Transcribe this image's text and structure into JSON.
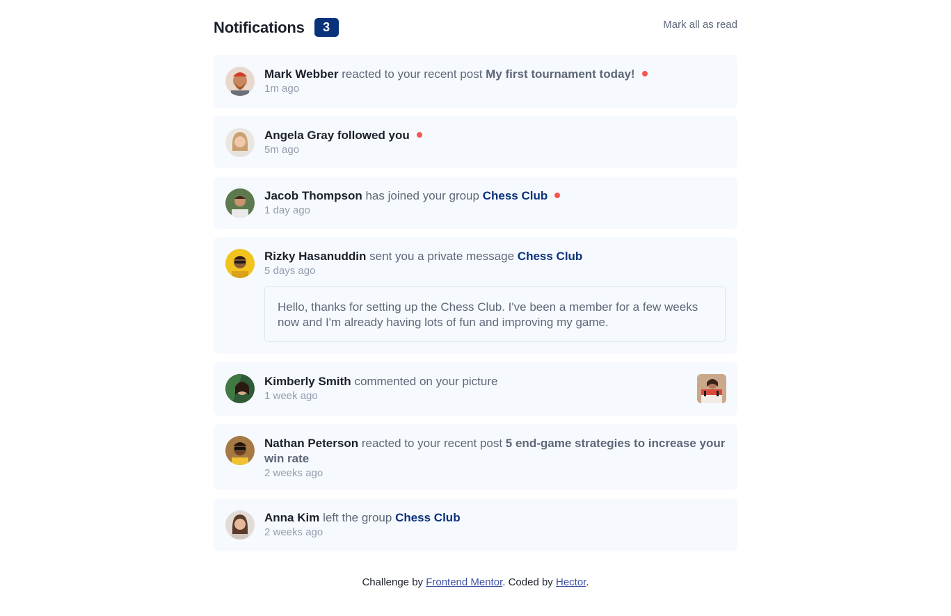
{
  "header": {
    "title": "Notifications",
    "unread_count": "3",
    "mark_all_label": "Mark all as read"
  },
  "notifications": [
    {
      "name": "Mark Webber",
      "action": "reacted to your recent post",
      "target": "My first tournament today!",
      "target_type": "post",
      "time": "1m ago",
      "unread": true,
      "avatar": "avatar-mark-webber"
    },
    {
      "name": "Angela Gray",
      "action": "followed you",
      "target": "",
      "time": "5m ago",
      "unread": true,
      "avatar": "avatar-angela-gray"
    },
    {
      "name": "Jacob Thompson",
      "action": "has joined your group",
      "target": "Chess Club",
      "target_type": "group",
      "time": "1 day ago",
      "unread": true,
      "avatar": "avatar-jacob-thompson"
    },
    {
      "name": "Rizky Hasanuddin",
      "action": "sent you a private message",
      "target": "Chess Club",
      "target_type": "group",
      "time": "5 days ago",
      "unread": false,
      "avatar": "avatar-rizky-hasanuddin",
      "message": "Hello, thanks for setting up the Chess Club. I've been a member for a few weeks now and I'm already having lots of fun and improving my game."
    },
    {
      "name": "Kimberly Smith",
      "action": "commented on your picture",
      "target": "",
      "time": "1 week ago",
      "unread": false,
      "avatar": "avatar-kimberly-smith",
      "picture": "chess-picture-thumbnail"
    },
    {
      "name": "Nathan Peterson",
      "action": "reacted to your recent post",
      "target": "5 end-game strategies to increase your win rate",
      "target_type": "post",
      "time": "2 weeks ago",
      "unread": false,
      "avatar": "avatar-nathan-peterson"
    },
    {
      "name": "Anna Kim",
      "action": "left the group",
      "target": "Chess Club",
      "target_type": "group",
      "time": "2 weeks ago",
      "unread": false,
      "avatar": "avatar-anna-kim"
    }
  ],
  "footer": {
    "prefix": "Challenge by",
    "link1": "Frontend Mentor",
    "middle": ". Coded by",
    "link2": "Hector",
    "suffix": "."
  },
  "colors": {
    "accent_blue": "#0a327b",
    "unread_dot": "#f65552",
    "card_bg": "#f6f9fd",
    "text_dark": "#1c202b",
    "text_muted": "#5e6778",
    "text_light": "#939cad"
  }
}
